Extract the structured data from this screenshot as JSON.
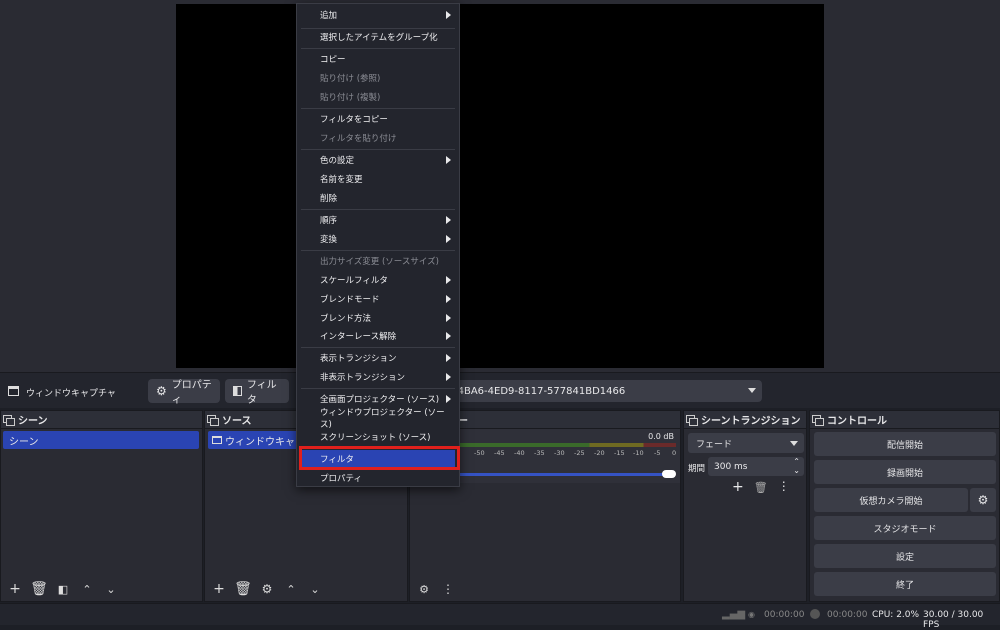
{
  "source_toolbar": {
    "source_name": "ウィンドウキャプチャ",
    "properties_label": "プロパティ",
    "filters_label": "フィルタ",
    "window_value": "-4BA6-4ED9-8117-577841BD1466"
  },
  "docks": {
    "scenes": {
      "title": "シーン",
      "items": [
        "シーン"
      ]
    },
    "sources": {
      "title": "ソース",
      "items": [
        "ウィンドウキャプチャ"
      ]
    },
    "mixer": {
      "title": "ー",
      "level": "0.0 dB",
      "ticks": [
        "-50",
        "-45",
        "-40",
        "-35",
        "-30",
        "-25",
        "-20",
        "-15",
        "-10",
        "-5",
        "0"
      ]
    },
    "transitions": {
      "title": "シーントランジション",
      "type": "フェード",
      "duration_label": "期間",
      "duration_value": "300 ms"
    },
    "controls": {
      "title": "コントロール",
      "start_stream": "配信開始",
      "start_record": "録画開始",
      "virtual_cam": "仮想カメラ開始",
      "studio_mode": "スタジオモード",
      "settings": "設定",
      "exit": "終了"
    }
  },
  "status_bar": {
    "stream_time": "00:00:00",
    "record_time": "00:00:00",
    "cpu": "CPU: 2.0%",
    "fps": "30.00 / 30.00 FPS"
  },
  "context_menu": {
    "add": "追加",
    "group": "選択したアイテムをグループ化",
    "copy": "コピー",
    "paste_ref": "貼り付け (参照)",
    "paste_dup": "貼り付け (複製)",
    "copy_filters": "フィルタをコピー",
    "paste_filters": "フィルタを貼り付け",
    "color": "色の設定",
    "rename": "名前を変更",
    "delete": "削除",
    "order": "順序",
    "transform": "変換",
    "resize_output": "出力サイズ変更 (ソースサイズ)",
    "scale_filter": "スケールフィルタ",
    "blend_mode": "ブレンドモード",
    "blend_method": "ブレンド方法",
    "deinterlace": "インターレース解除",
    "show_transition": "表示トランジション",
    "hide_transition": "非表示トランジション",
    "fullscreen_projector": "全画面プロジェクター (ソース)",
    "windowed_projector": "ウィンドウプロジェクター (ソース)",
    "screenshot": "スクリーンショット (ソース)",
    "filters": "フィルタ",
    "properties": "プロパティ"
  },
  "colors": {
    "accent": "#2a44b3",
    "highlight_box": "#e0201c",
    "background": "#1d1f26"
  }
}
